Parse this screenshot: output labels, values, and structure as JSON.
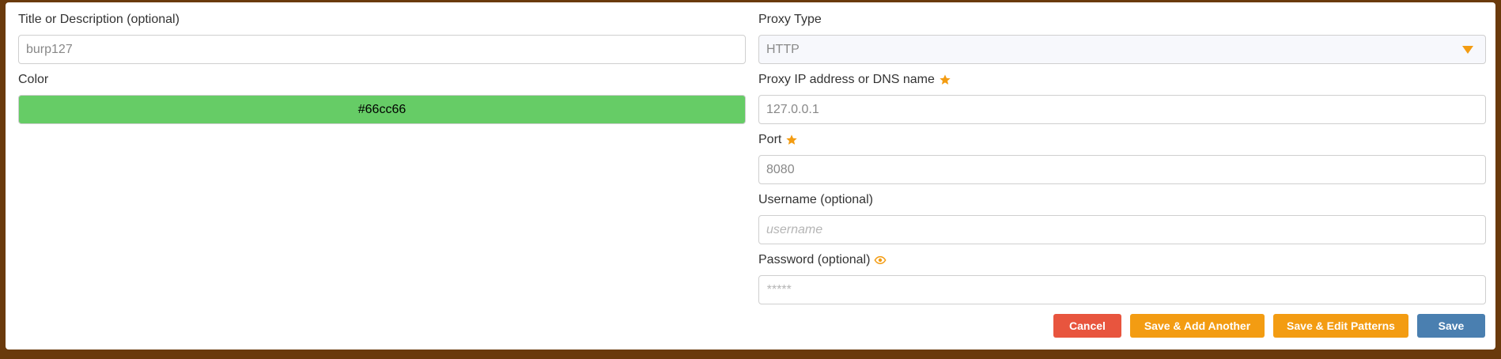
{
  "left": {
    "title": {
      "label": "Title or Description (optional)",
      "value": "burp127"
    },
    "color": {
      "label": "Color",
      "value": "#66cc66"
    }
  },
  "right": {
    "proxy_type": {
      "label": "Proxy Type",
      "value": "HTTP"
    },
    "proxy_ip": {
      "label": "Proxy IP address or DNS name",
      "value": "127.0.0.1",
      "required_icon": "star-icon"
    },
    "port": {
      "label": "Port",
      "value": "8080",
      "required_icon": "star-icon"
    },
    "username": {
      "label": "Username (optional)",
      "placeholder": "username"
    },
    "password": {
      "label": "Password (optional)",
      "placeholder": "*****",
      "toggle_icon": "eye-icon"
    }
  },
  "buttons": {
    "cancel": "Cancel",
    "save_add": "Save & Add Another",
    "save_patterns": "Save & Edit Patterns",
    "save": "Save"
  },
  "colors": {
    "frame": "#6a3a0c",
    "accent": "#f39c12",
    "cancel": "#e8553e",
    "save": "#4a7fb0",
    "swatch": "#66cc66"
  }
}
